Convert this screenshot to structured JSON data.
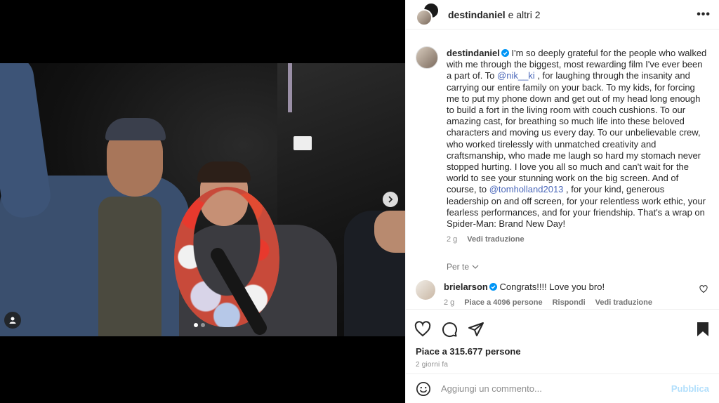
{
  "post": {
    "header": {
      "username": "destindaniel",
      "others": "e altri 2",
      "more_label": "•••"
    },
    "media": {
      "next_icon": "chevron-right-icon",
      "tag_icon": "user-tag-icon",
      "slide_count": 2,
      "active_slide": 1
    },
    "caption": {
      "username": "destindaniel",
      "text_1": " I'm so deeply grateful for the people who walked with me through the biggest, most rewarding film I've ever been a part of. To ",
      "mention_1": "@nik__ki",
      "text_2": " , for laughing through the insanity and carrying our entire family on your back. To my kids, for forcing me to put my phone down and get out of my head long enough to build a fort in the living room with couch cushions. To our amazing cast, for breathing so much life into these beloved characters and moving us every day. To our unbelievable crew, who worked tirelessly with unmatched creativity and craftsmanship, who made me laugh so hard my stomach never stopped hurting. I love you all so much and can't wait for the world to see your stunning work on the big screen. And of course, to ",
      "mention_2": "@tomholland2013",
      "text_3": " , for your kind, generous leadership on and off screen, for your relentless work ethic, your fearless performances, and for your friendship. That's a wrap on Spider-Man: Brand New Day!",
      "time": "2 g",
      "translate": "Vedi traduzione"
    },
    "for_you": "Per te",
    "comments": [
      {
        "username": "brielarson",
        "text": " Congrats!!!! Love you bro!",
        "time": "2 g",
        "likes": "Piace a 4096 persone",
        "reply": "Rispondi",
        "translate": "Vedi traduzione"
      }
    ],
    "likes": "Piace a 315.677 persone",
    "posted": "2 giorni fa",
    "add_comment": {
      "placeholder": "Aggiungi un commento...",
      "publish": "Pubblica"
    },
    "colors": {
      "verified": "#0095f6",
      "mention": "#4a67b9",
      "publish_disabled": "#b2dffc"
    }
  }
}
